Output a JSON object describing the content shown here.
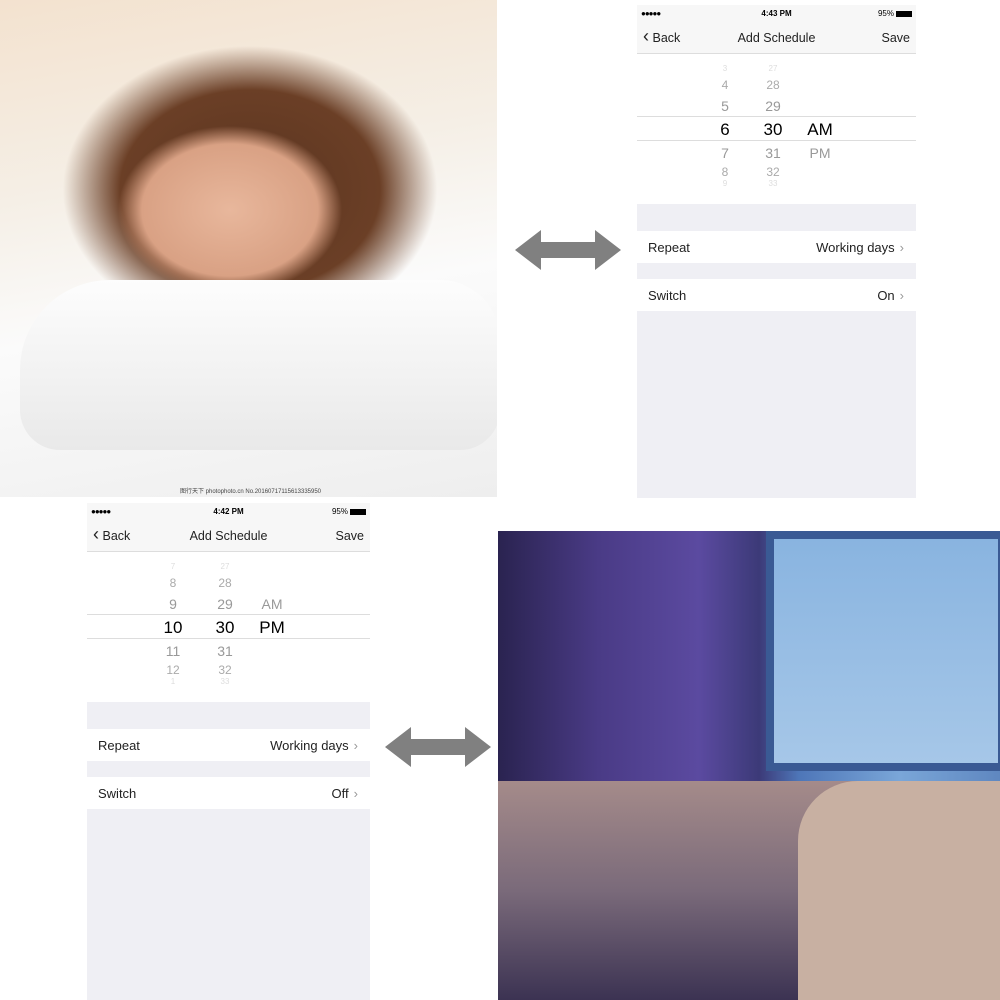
{
  "top_photo": {
    "watermark": "图行天下 photophoto.cn  No.20160717115613335950"
  },
  "phones": [
    {
      "status": {
        "signal": "●●●●●",
        "time": "4:43 PM",
        "battery": "95%"
      },
      "nav": {
        "back": "Back",
        "title": "Add Schedule",
        "save": "Save"
      },
      "picker": {
        "hours": [
          "3",
          "4",
          "5",
          "6",
          "7",
          "8",
          "9"
        ],
        "minutes": [
          "27",
          "28",
          "29",
          "30",
          "31",
          "32",
          "33"
        ],
        "ampm_above": "",
        "ampm_selected": "AM",
        "ampm_below": "PM"
      },
      "repeat": {
        "label": "Repeat",
        "value": "Working days"
      },
      "switch": {
        "label": "Switch",
        "value": "On"
      }
    },
    {
      "status": {
        "signal": "●●●●●",
        "time": "4:42 PM",
        "battery": "95%"
      },
      "nav": {
        "back": "Back",
        "title": "Add Schedule",
        "save": "Save"
      },
      "picker": {
        "hours": [
          "7",
          "8",
          "9",
          "10",
          "11",
          "12",
          "1"
        ],
        "minutes": [
          "27",
          "28",
          "29",
          "30",
          "31",
          "32",
          "33"
        ],
        "ampm_above": "AM",
        "ampm_selected": "PM",
        "ampm_below": ""
      },
      "repeat": {
        "label": "Repeat",
        "value": "Working days"
      },
      "switch": {
        "label": "Switch",
        "value": "Off"
      }
    }
  ],
  "icons": {
    "chevron": "›",
    "back": "‹"
  },
  "colors": {
    "arrow": "#808080",
    "background": "#efeff4"
  }
}
